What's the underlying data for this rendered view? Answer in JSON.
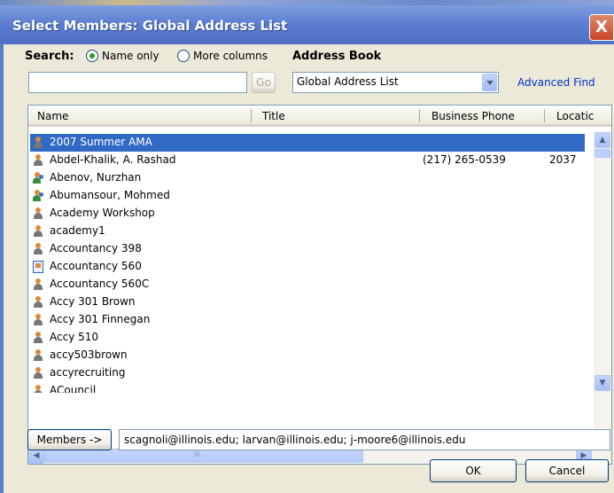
{
  "window": {
    "title": "Select Members: Global Address List",
    "close_glyph": "X"
  },
  "search": {
    "label": "Search:",
    "option_name_only": "Name only",
    "option_more_columns": "More columns",
    "selected": "name_only",
    "input_value": "",
    "go_label": "Go"
  },
  "address_book": {
    "label": "Address Book",
    "selected": "Global Address List",
    "advanced_find": "Advanced Find"
  },
  "columns": [
    "Name",
    "Title",
    "Business Phone",
    "Locatic"
  ],
  "rows": [
    {
      "name": "2007 Summer AMA",
      "phone": "",
      "location": "",
      "icon": "person-icon",
      "selected": true
    },
    {
      "name": "Abdel-Khalik, A. Rashad",
      "phone": "(217) 265-0539",
      "location": "2037",
      "icon": "person-icon",
      "selected": false
    },
    {
      "name": "Abenov, Nurzhan",
      "phone": "",
      "location": "",
      "icon": "contact-icon",
      "selected": false
    },
    {
      "name": "Abumansour, Mohmed",
      "phone": "",
      "location": "",
      "icon": "contact-icon",
      "selected": false
    },
    {
      "name": "Academy Workshop",
      "phone": "",
      "location": "",
      "icon": "person-icon",
      "selected": false
    },
    {
      "name": "academy1",
      "phone": "",
      "location": "",
      "icon": "person-icon",
      "selected": false
    },
    {
      "name": "Accountancy 398",
      "phone": "",
      "location": "",
      "icon": "person-icon",
      "selected": false
    },
    {
      "name": "Accountancy 560",
      "phone": "",
      "location": "",
      "icon": "room-icon",
      "selected": false
    },
    {
      "name": "Accountancy 560C",
      "phone": "",
      "location": "",
      "icon": "person-icon",
      "selected": false
    },
    {
      "name": "Accy 301 Brown",
      "phone": "",
      "location": "",
      "icon": "person-icon",
      "selected": false
    },
    {
      "name": "Accy 301 Finnegan",
      "phone": "",
      "location": "",
      "icon": "person-icon",
      "selected": false
    },
    {
      "name": "Accy 510",
      "phone": "",
      "location": "",
      "icon": "person-icon",
      "selected": false
    },
    {
      "name": "accy503brown",
      "phone": "",
      "location": "",
      "icon": "person-icon",
      "selected": false
    },
    {
      "name": "accyrecruiting",
      "phone": "",
      "location": "",
      "icon": "person-icon",
      "selected": false
    },
    {
      "name": "ACouncil",
      "phone": "",
      "location": "",
      "icon": "person-icon",
      "selected": false
    }
  ],
  "members": {
    "button_label": "Members ->",
    "value": "scagnoli@illinois.edu; larvan@illinois.edu; j-moore6@illinois.edu"
  },
  "footer": {
    "ok_label": "OK",
    "cancel_label": "Cancel"
  },
  "scroll_glyphs": {
    "up": "▲",
    "down": "▼",
    "left": "◀",
    "right": "▶",
    "grip": "III"
  }
}
